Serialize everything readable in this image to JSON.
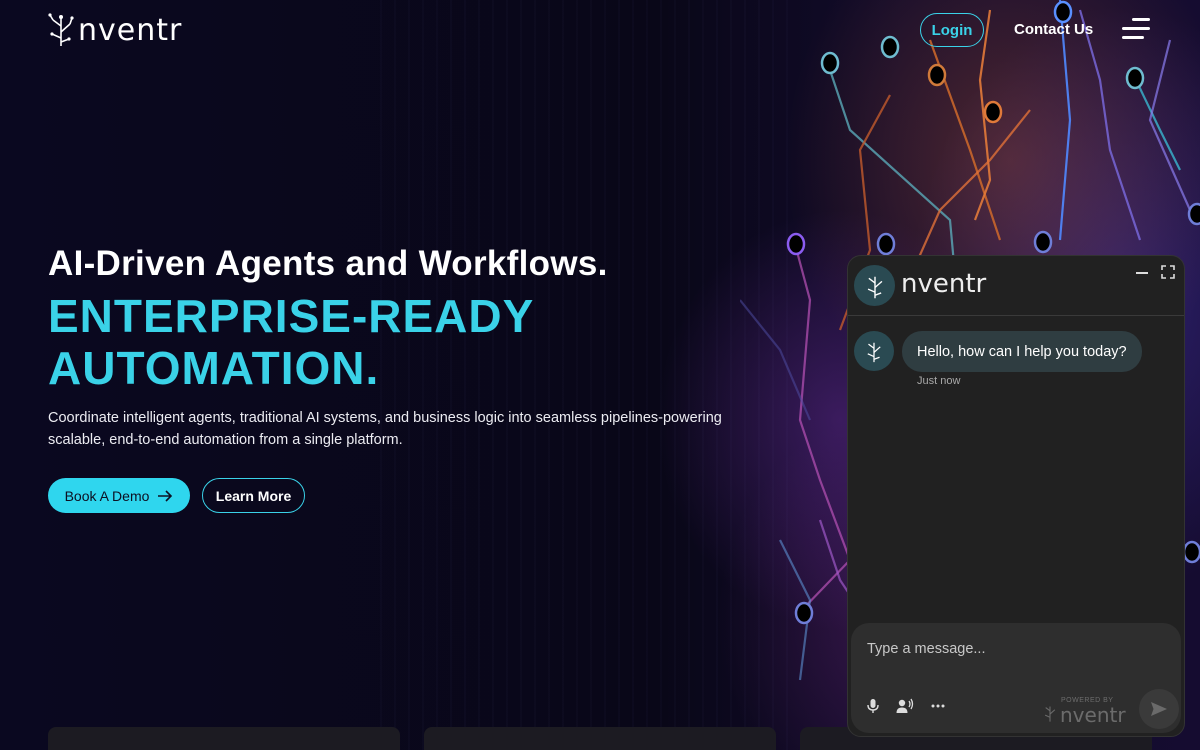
{
  "header": {
    "brand": "nventr",
    "login_label": "Login",
    "contact_label": "Contact Us",
    "menu_icon": "hamburger-menu-icon"
  },
  "hero": {
    "title": "AI-Driven Agents and Workflows.",
    "accent_line1": "ENTERPRISE-READY",
    "accent_line2": "AUTOMATION.",
    "description": "Coordinate intelligent agents, traditional AI systems, and business logic into seamless pipelines-powering scalable, end-to-end automation from a single platform.",
    "demo_label": "Book A Demo",
    "learn_label": "Learn More"
  },
  "chat": {
    "brand": "nventr",
    "message": "Hello, how can I help you today?",
    "timestamp": "Just now",
    "placeholder": "Type a message...",
    "powered_by": "POWERED BY",
    "powered_brand": "nventr"
  },
  "colors": {
    "accent": "#3ad2e8",
    "background": "#07061a",
    "chat_bg": "#212121"
  }
}
